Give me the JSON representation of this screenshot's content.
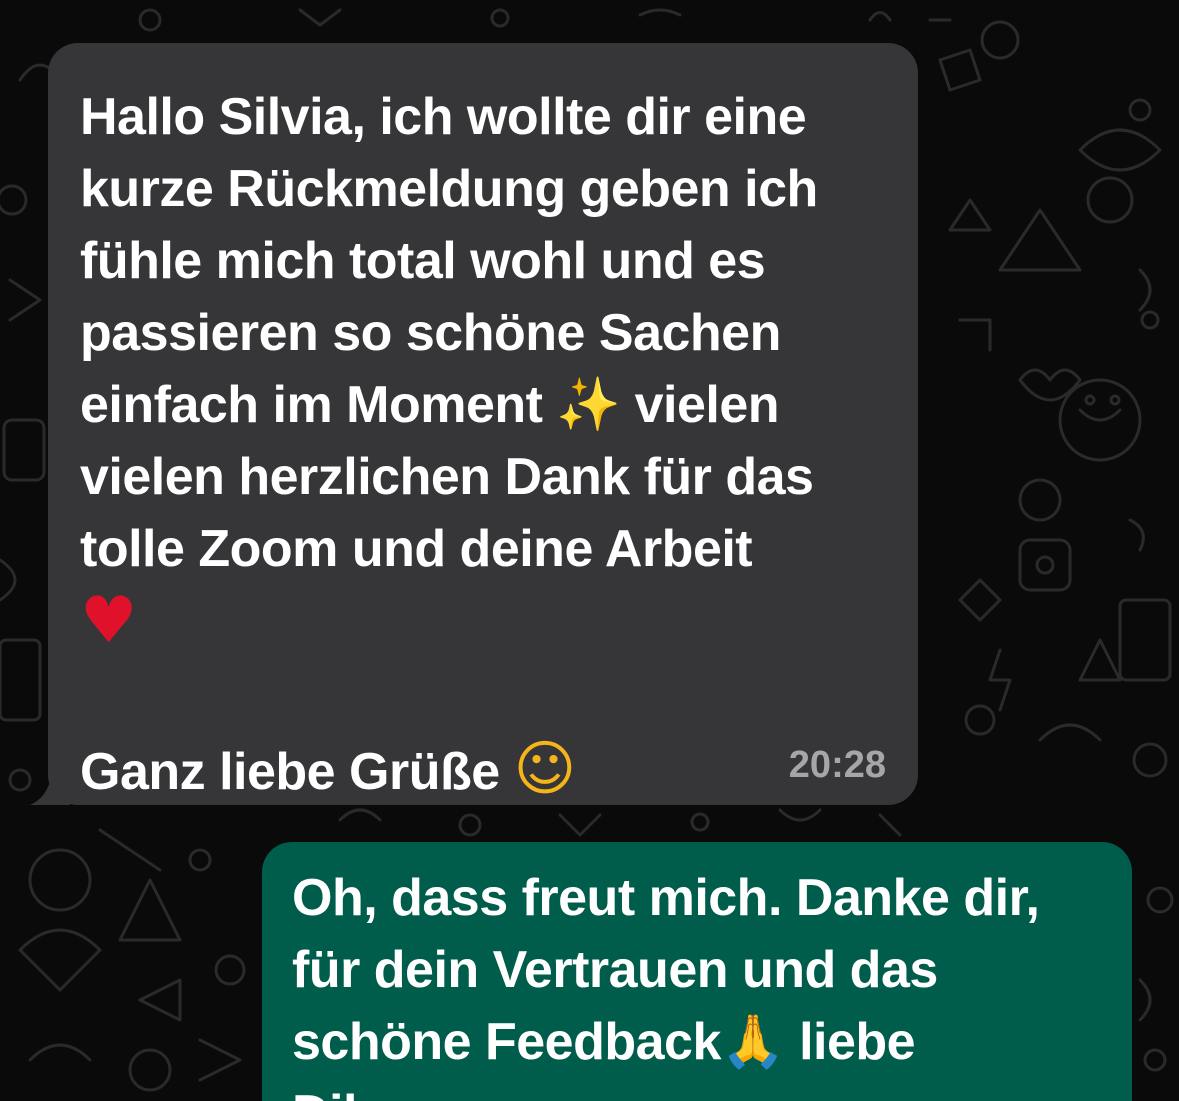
{
  "chat": {
    "incoming": {
      "line1": "Hallo Silvia, ich wollte dir eine",
      "line2": "kurze Rückmeldung geben ich",
      "line3": "fühle mich total wohl und es",
      "line4": "passieren so schöne Sachen",
      "line5_a": "einfach im Moment ",
      "line5_b": " vielen",
      "line6": "vielen herzlichen Dank für das",
      "line7": "tolle Zoom und deine Arbeit",
      "line9": "Ganz liebe Grüße ",
      "time": "20:28"
    },
    "outgoing": {
      "line1": "Oh, dass freut mich. Danke dir,",
      "line2": "für dein Vertrauen und das",
      "line3_a": "schöne Feedback",
      "line3_b": " liebe",
      "line4": "Dilara"
    }
  },
  "icons": {
    "sparkles": "✨",
    "heart": "♥",
    "smiling_face_hearts": "☺",
    "folded_hands": "🙏"
  },
  "colors": {
    "background": "#0a0a0a",
    "incoming_bubble": "#363638",
    "outgoing_bubble": "#005c4b",
    "text": "#ffffff",
    "timestamp": "#a6a6aa"
  }
}
